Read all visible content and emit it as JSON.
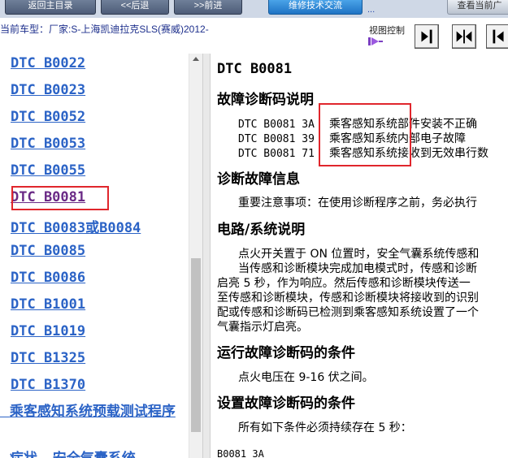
{
  "nav": {
    "back_home": "返回主目录",
    "back": "<<后退",
    "forward": ">>前进",
    "module": "维修技术交流",
    "trailing": "...",
    "right_button": "查看当前广"
  },
  "vehicle": {
    "current": "当前车型：厂家:S-上海凯迪拉克SLS(赛威)2012-"
  },
  "view_control": {
    "label": "视图控制"
  },
  "sidebar": {
    "items": [
      {
        "label": "DTC  B0022"
      },
      {
        "label": "DTC  B0023"
      },
      {
        "label": "DTC  B0052"
      },
      {
        "label": "DTC  B0053"
      },
      {
        "label": "DTC  B0055"
      },
      {
        "label": "DTC  B0081"
      },
      {
        "label": "DTC  B0083或B0084"
      },
      {
        "label": "DTC  B0085"
      },
      {
        "label": "DTC  B0086"
      },
      {
        "label": "DTC  B1001"
      },
      {
        "label": "DTC  B1019"
      },
      {
        "label": "DTC  B1325"
      },
      {
        "label": "DTC  B1370"
      },
      {
        "label": "  乘客感知系统预载测试程序"
      },
      {
        "label": "  症状 - 安全气囊系统"
      }
    ]
  },
  "content": {
    "title": "DTC  B0081",
    "sections": {
      "desc_heading": "故障诊断码说明",
      "codes": [
        {
          "code": "DTC B0081 3A",
          "desc": "乘客感知系统部件安装不正确"
        },
        {
          "code": "DTC B0081 39",
          "desc": "乘客感知系统内部电子故障"
        },
        {
          "code": "DTC B0081 71",
          "desc": "乘客感知系统接收到无效串行数"
        }
      ],
      "diag_heading": "诊断故障信息",
      "diag_text": "重要注意事项：在使用诊断程序之前，务必执行",
      "circuit_heading": "电路/系统说明",
      "circuit_lines": [
        "点火开关置于 ON 位置时，安全气囊系统传感和",
        "当传感和诊断模块完成加电模式时，传感和诊断",
        "启亮 5 秒，作为响应。然后传感和诊断模块传送一",
        "至传感和诊断模块，传感和诊断模块将接收到的识别",
        "配或传感和诊断码已检测到乘客感知系统设置了一个",
        "气囊指示灯启亮。"
      ],
      "run_heading": "运行故障诊断码的条件",
      "run_text": "点火电压在 9-16 伏之间。",
      "set_heading": "设置故障诊断码的条件",
      "set_text": "所有如下条件必须持续存在 5 秒：",
      "set_code": "B0081 3A"
    }
  },
  "colors": {
    "link": "#2b63c6",
    "visited": "#6a2a86",
    "highlight_box": "#e0262c",
    "vehicle_text": "#1d2f8c"
  }
}
